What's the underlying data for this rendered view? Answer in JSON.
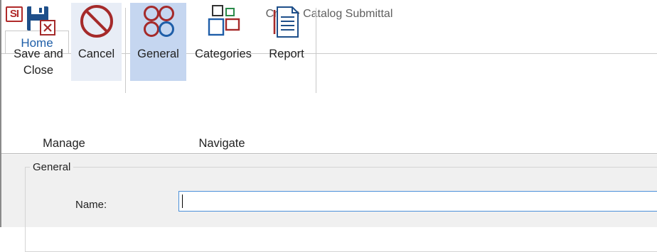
{
  "app": {
    "logo_text": "SI",
    "title": "Create Catalog Submittal"
  },
  "tabs": [
    {
      "label": "Home",
      "active": true
    }
  ],
  "ribbon": {
    "groups": [
      {
        "label": "Manage",
        "buttons": [
          {
            "label_line1": "Save and",
            "label_line2": "Close",
            "icon": "save-close-icon"
          },
          {
            "label": "Cancel",
            "icon": "cancel-icon"
          }
        ]
      },
      {
        "label": "Navigate",
        "buttons": [
          {
            "label": "General",
            "icon": "general-circles-icon",
            "selected": true
          },
          {
            "label": "Categories",
            "icon": "categories-icon"
          },
          {
            "label": "Report",
            "icon": "report-icon"
          }
        ]
      }
    ]
  },
  "form": {
    "section_title": "General",
    "fields": [
      {
        "label": "Name:",
        "value": ""
      }
    ]
  },
  "colors": {
    "accent_blue": "#1e5ea8",
    "brand_red": "#a52a2a",
    "selected_bg": "#c5d6f0",
    "hover_bg": "#e8edf6"
  }
}
